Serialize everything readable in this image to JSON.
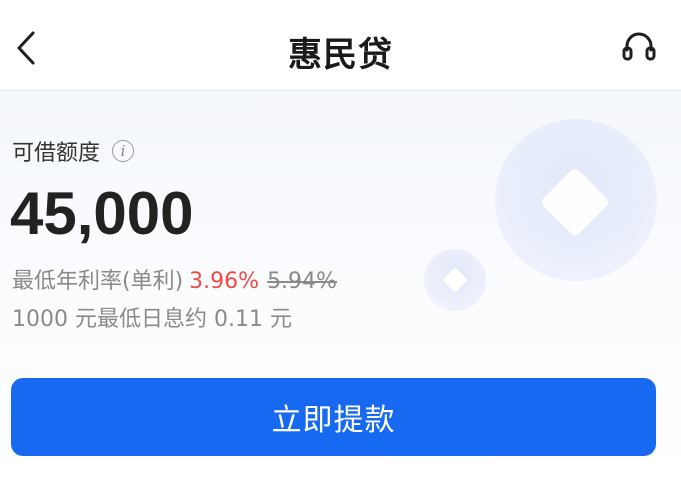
{
  "header": {
    "title": "惠民贷",
    "back_icon": "chevron-left-icon",
    "service_icon": "headset-icon"
  },
  "loan": {
    "limit_label": "可借额度",
    "info_icon_glyph": "i",
    "amount": "45,000",
    "rate_label": "最低年利率(单利)",
    "rate_current": "3.96%",
    "rate_original": "5.94%",
    "daily_interest": "1000 元最低日息约 0.11 元"
  },
  "action": {
    "withdraw_label": "立即提款"
  },
  "colors": {
    "primary": "#1769f2",
    "rate_highlight": "#f04a45"
  }
}
